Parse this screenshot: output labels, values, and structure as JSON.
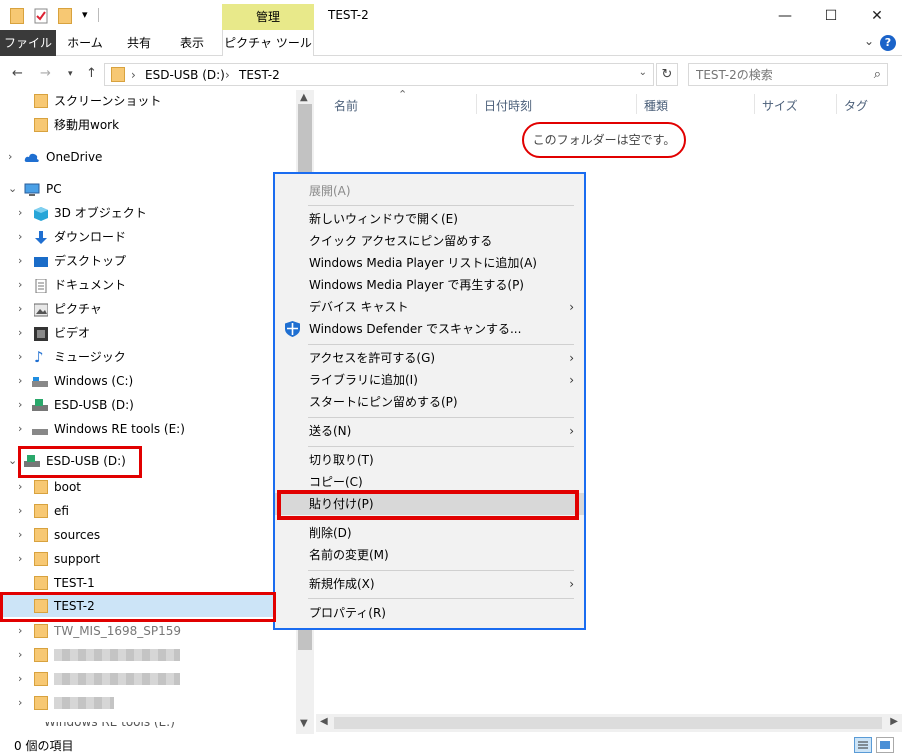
{
  "titlebar": {
    "context_tab_header": "管理",
    "window_title": "TEST-2",
    "minimize_glyph": "—",
    "maximize_glyph": "☐",
    "close_glyph": "✕"
  },
  "ribbon": {
    "tabs": [
      "ファイル",
      "ホーム",
      "共有",
      "表示",
      "ピクチャ ツール"
    ],
    "collapse_glyph": "⌄",
    "help_glyph": "?"
  },
  "address_bar": {
    "crumbs": [
      "ESD-USB (D:)",
      "TEST-2"
    ],
    "separator": "›",
    "search_placeholder": "TEST-2の検索"
  },
  "nav_tree": [
    {
      "label": "スクリーンショット",
      "icon": "folder-icon",
      "chevron": ""
    },
    {
      "label": "移動用work",
      "icon": "folder-icon",
      "chevron": ""
    },
    {
      "label": "OneDrive",
      "icon": "cloud-icon",
      "chevron": "›"
    },
    {
      "label": "PC",
      "icon": "computer-icon",
      "chevron": "⌄"
    },
    {
      "label": "3D オブジェクト",
      "icon": "cube-icon",
      "chevron": "›"
    },
    {
      "label": "ダウンロード",
      "icon": "download-arrow-icon",
      "chevron": "›"
    },
    {
      "label": "デスクトップ",
      "icon": "desktop-icon",
      "chevron": "›"
    },
    {
      "label": "ドキュメント",
      "icon": "document-icon",
      "chevron": "›"
    },
    {
      "label": "ピクチャ",
      "icon": "picture-icon",
      "chevron": "›"
    },
    {
      "label": "ビデオ",
      "icon": "film-icon",
      "chevron": "›"
    },
    {
      "label": "ミュージック",
      "icon": "music-note-icon",
      "chevron": "›"
    },
    {
      "label": "Windows (C:)",
      "icon": "drive-icon",
      "chevron": "›"
    },
    {
      "label": "ESD-USB (D:)",
      "icon": "usb-drive-icon",
      "chevron": "›"
    },
    {
      "label": "Windows RE tools (E:)",
      "icon": "drive-icon",
      "chevron": "›"
    },
    {
      "label": "ESD-USB (D:)",
      "icon": "usb-drive-icon",
      "chevron": "⌄"
    },
    {
      "label": "boot",
      "icon": "folder-icon",
      "chevron": "›"
    },
    {
      "label": "efi",
      "icon": "folder-icon",
      "chevron": "›"
    },
    {
      "label": "sources",
      "icon": "folder-icon",
      "chevron": "›"
    },
    {
      "label": "support",
      "icon": "folder-icon",
      "chevron": "›"
    },
    {
      "label": "TEST-1",
      "icon": "folder-icon",
      "chevron": ""
    },
    {
      "label": "TEST-2",
      "icon": "folder-icon",
      "chevron": ""
    },
    {
      "label": "TW_MIS_1698_SP159",
      "icon": "folder-icon",
      "chevron": "›"
    }
  ],
  "nav_tree_bottom_partial": "Windows RE tools (E:)",
  "columns": [
    "名前",
    "日付時刻",
    "種類",
    "サイズ",
    "タグ"
  ],
  "empty_message": "このフォルダーは空です。",
  "context_menu": [
    {
      "label": "展開(A)",
      "disabled": true,
      "submenu": false
    },
    {
      "separator": true
    },
    {
      "label": "新しいウィンドウで開く(E)",
      "submenu": false
    },
    {
      "label": "クイック アクセスにピン留めする",
      "submenu": false
    },
    {
      "label": "Windows Media Player リストに追加(A)",
      "submenu": false
    },
    {
      "label": "Windows Media Player で再生する(P)",
      "submenu": false
    },
    {
      "label": "デバイス キャスト",
      "submenu": true
    },
    {
      "label": "Windows Defender でスキャンする...",
      "submenu": false,
      "icon": "shield-icon"
    },
    {
      "separator": true
    },
    {
      "label": "アクセスを許可する(G)",
      "submenu": true
    },
    {
      "label": "ライブラリに追加(I)",
      "submenu": true
    },
    {
      "label": "スタートにピン留めする(P)",
      "submenu": false
    },
    {
      "separator": true
    },
    {
      "label": "送る(N)",
      "submenu": true
    },
    {
      "separator": true
    },
    {
      "label": "切り取り(T)",
      "submenu": false
    },
    {
      "label": "コピー(C)",
      "submenu": false
    },
    {
      "label": "貼り付け(P)",
      "submenu": false,
      "highlighted": true
    },
    {
      "separator": true
    },
    {
      "label": "削除(D)",
      "submenu": false
    },
    {
      "label": "名前の変更(M)",
      "submenu": false
    },
    {
      "separator": true
    },
    {
      "label": "新規作成(X)",
      "submenu": true
    },
    {
      "separator": true
    },
    {
      "label": "プロパティ(R)",
      "submenu": false
    }
  ],
  "status": {
    "item_count": "0 個の項目"
  },
  "colors": {
    "highlight_red": "#e10000",
    "menu_border_blue": "#1a6cf0",
    "selected_row": "#cce4f7",
    "context_tab": "#e8e98a"
  }
}
